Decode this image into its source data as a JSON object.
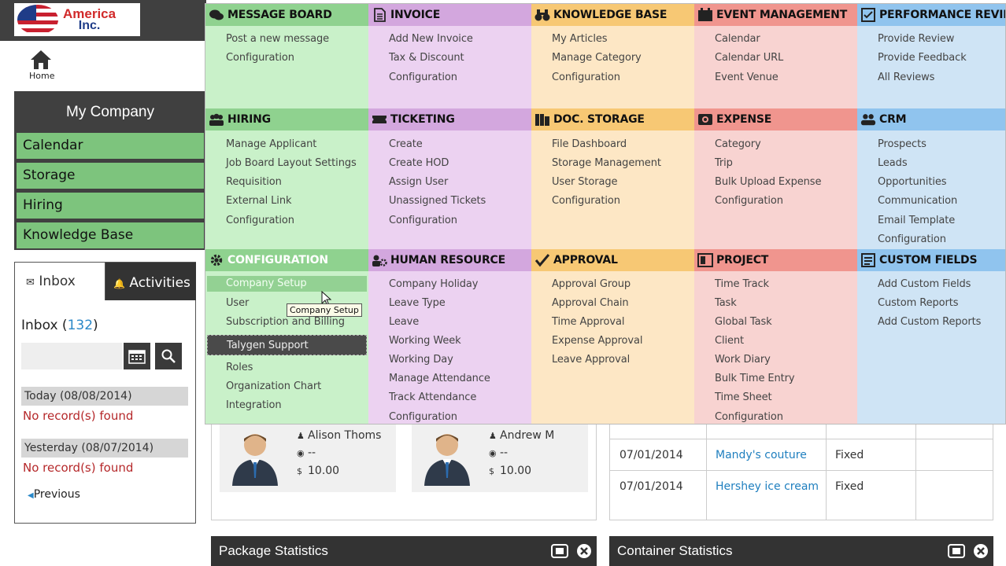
{
  "brand": {
    "line1": "America",
    "line2": "Inc."
  },
  "home": {
    "label": "Home"
  },
  "company": {
    "title": "My Company",
    "items": [
      "Calendar",
      "Storage",
      "Hiring",
      "Knowledge Base"
    ]
  },
  "inbox": {
    "tab_inbox": "Inbox",
    "tab_activities": "Activities",
    "count_label": "Inbox (",
    "count": "132",
    "count_close": ")",
    "search_value": "",
    "today": "Today (08/08/2014)",
    "today_msg": "No record(s) found",
    "yesterday": "Yesterday (08/07/2014)",
    "yesterday_msg": "No record(s) found",
    "previous": "Previous"
  },
  "people": [
    {
      "name": "Alison Thoms",
      "views": "--",
      "amount": "10.00",
      "icon_user": "user-icon",
      "icon_eye": "eye-icon",
      "currency": "$"
    },
    {
      "name": "Andrew M",
      "views": "--",
      "amount": "10.00",
      "icon_user": "user-icon",
      "icon_eye": "eye-icon",
      "currency": "$"
    }
  ],
  "table_rows": [
    {
      "date": "07/01/2014",
      "name": "Mandy's couture",
      "type": "Fixed"
    },
    {
      "date": "07/01/2014",
      "name": "Hershey ice cream",
      "type": "Fixed"
    }
  ],
  "stats": {
    "package": "Package Statistics",
    "container": "Container Statistics"
  },
  "colors": {
    "green": "#c9f1c9",
    "green_head": "#8fd28f",
    "purple": "#ecd2f1",
    "purple_head": "#d3a7de",
    "orange": "#fde7c5",
    "orange_head": "#f7c874",
    "red": "#f8d3d1",
    "red_head": "#f0958e",
    "blue": "#cfe4f5",
    "blue_head": "#90c4ee"
  },
  "menu": {
    "message_board": {
      "title": "MESSAGE BOARD",
      "icon": "chat-icon",
      "items": [
        "Post a new message",
        "Configuration"
      ]
    },
    "invoice": {
      "title": "INVOICE",
      "icon": "document-icon",
      "items": [
        "Add New Invoice",
        "Tax & Discount",
        "Configuration"
      ]
    },
    "knowledge_base": {
      "title": "KNOWLEDGE BASE",
      "icon": "binoculars-icon",
      "items": [
        "My Articles",
        "Manage Category",
        "Configuration"
      ]
    },
    "event_management": {
      "title": "EVENT MANAGEMENT",
      "icon": "calendar-icon",
      "items": [
        "Calendar",
        "Calendar URL",
        "Event Venue"
      ]
    },
    "performance_review": {
      "title": "PERFORMANCE REVIEW",
      "icon": "checklist-icon",
      "items": [
        "Provide Review",
        "Provide Feedback",
        "All Reviews"
      ]
    },
    "hiring": {
      "title": "HIRING",
      "icon": "group-icon",
      "items": [
        "Manage Applicant",
        "Job Board Layout Settings",
        "Requisition",
        "External Link",
        "Configuration"
      ]
    },
    "ticketing": {
      "title": "TICKETING",
      "icon": "ticket-icon",
      "items": [
        "Create",
        "Create HOD",
        "Assign User",
        "Unassigned Tickets",
        "Configuration"
      ]
    },
    "doc_storage": {
      "title": "DOC. STORAGE",
      "icon": "storage-icon",
      "items": [
        "File Dashboard",
        "Storage Management",
        "User Storage",
        "Configuration"
      ]
    },
    "expense": {
      "title": "EXPENSE",
      "icon": "money-icon",
      "items": [
        "Category",
        "Trip",
        "Bulk Upload Expense",
        "Configuration"
      ]
    },
    "crm": {
      "title": "CRM",
      "icon": "users-icon",
      "items": [
        "Prospects",
        "Leads",
        "Opportunities",
        "Communication",
        "Email Template",
        "Configuration"
      ]
    },
    "configuration": {
      "title": "CONFIGURATION",
      "icon": "gear-icon",
      "items": [
        "Company Setup",
        "User",
        "Subscription and Billing",
        "Talygen Support",
        "Roles",
        "Organization Chart",
        "Integration"
      ]
    },
    "human_resource": {
      "title": "HUMAN RESOURCE",
      "icon": "people-gear-icon",
      "items": [
        "Company Holiday",
        "Leave Type",
        "Leave",
        "Working Week",
        "Working Day",
        "Manage Attendance",
        "Track Attendance",
        "Configuration"
      ]
    },
    "approval": {
      "title": "APPROVAL",
      "icon": "check-icon",
      "items": [
        "Approval Group",
        "Approval Chain",
        "Time Approval",
        "Expense Approval",
        "Leave Approval"
      ]
    },
    "project": {
      "title": "PROJECT",
      "icon": "folder-icon",
      "items": [
        "Time Track",
        "Task",
        "Global Task",
        "Client",
        "Work Diary",
        "Bulk Time Entry",
        "Time Sheet",
        "Configuration"
      ]
    },
    "custom_fields": {
      "title": "CUSTOM FIELDS",
      "icon": "form-icon",
      "items": [
        "Add Custom Fields",
        "Custom Reports",
        "Add Custom Reports"
      ]
    }
  },
  "tooltip": "Company Setup"
}
